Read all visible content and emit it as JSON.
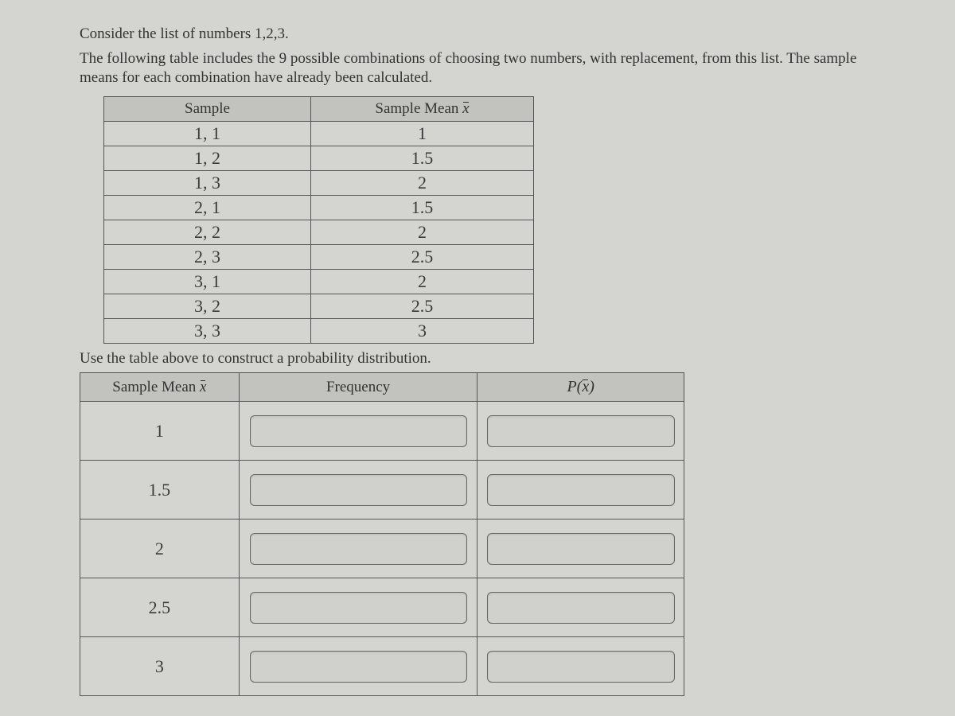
{
  "intro_line1": "Consider the list of numbers 1,2,3.",
  "intro_line2": "The following table includes the 9 possible combinations of choosing two numbers, with replacement, from this list. The sample means for each combination have already been calculated.",
  "table1": {
    "headers": {
      "col1": "Sample",
      "col2_prefix": "Sample Mean ",
      "col2_symbol": "x"
    },
    "rows": [
      {
        "sample": "1, 1",
        "mean": "1"
      },
      {
        "sample": "1, 2",
        "mean": "1.5"
      },
      {
        "sample": "1, 3",
        "mean": "2"
      },
      {
        "sample": "2, 1",
        "mean": "1.5"
      },
      {
        "sample": "2, 2",
        "mean": "2"
      },
      {
        "sample": "2, 3",
        "mean": "2.5"
      },
      {
        "sample": "3, 1",
        "mean": "2"
      },
      {
        "sample": "3, 2",
        "mean": "2.5"
      },
      {
        "sample": "3, 3",
        "mean": "3"
      }
    ]
  },
  "instruction2": "Use the table above to construct a probability distribution.",
  "table2": {
    "headers": {
      "col1_prefix": "Sample Mean ",
      "col1_symbol": "x",
      "col2": "Frequency",
      "col3_p": "P",
      "col3_symbol": "x"
    },
    "rows": [
      {
        "mean": "1"
      },
      {
        "mean": "1.5"
      },
      {
        "mean": "2"
      },
      {
        "mean": "2.5"
      },
      {
        "mean": "3"
      }
    ]
  }
}
